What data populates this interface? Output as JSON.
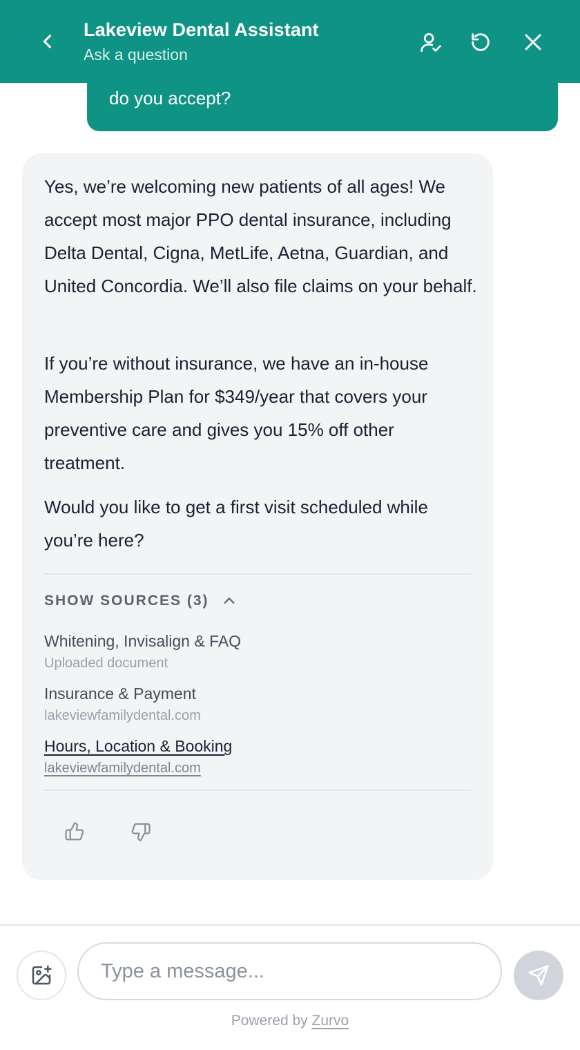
{
  "header": {
    "title": "Lakeview Dental Assistant",
    "subtitle": "Ask a question",
    "back_icon": "chevron-left-icon",
    "agent_icon": "user-check-icon",
    "reset_icon": "refresh-icon",
    "close_icon": "close-icon",
    "bg_color": "#0e9384"
  },
  "user_message": {
    "visible_text": "do you accept?"
  },
  "bot_message": {
    "paragraphs": [
      "Yes, we’re welcoming new patients of all ages! We accept most major PPO dental insurance, including Delta Dental, Cigna, MetLife, Aetna, Guardian, and United Concordia. We’ll also file claims on your behalf.",
      "If you’re without insurance, we have an in-house Membership Plan for $349/year that covers your preventive care and gives you 15% off other treatment.",
      "Would you like to get a first visit scheduled while you’re here?"
    ],
    "sources_label": "SHOW SOURCES (3)",
    "sources": [
      {
        "title": "Whitening, Invisalign & FAQ",
        "subtitle": "Uploaded document"
      },
      {
        "title": "Insurance & Payment",
        "subtitle": "lakeviewfamilydental.com"
      },
      {
        "title": "Hours, Location & Booking",
        "subtitle": "lakeviewfamilydental.com"
      }
    ],
    "feedback": {
      "up_icon": "thumbs-up-icon",
      "down_icon": "thumbs-down-icon"
    }
  },
  "composer": {
    "placeholder": "Type a message...",
    "attach_icon": "image-plus-icon",
    "send_icon": "send-icon"
  },
  "footer": {
    "powered_prefix": "Powered by",
    "brand": "Zurvo"
  }
}
